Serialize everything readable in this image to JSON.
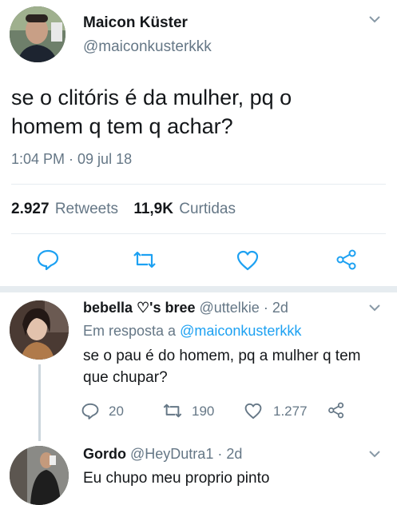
{
  "main_tweet": {
    "author_name": "Maicon Küster",
    "author_handle": "@maiconkusterkkk",
    "text_line1": "se o clitóris é da mulher, pq o",
    "text_line2": "homem q tem q achar?",
    "timestamp": "1:04 PM · 09 jul 18",
    "retweets_count": "2.927",
    "retweets_label": "Retweets",
    "likes_count": "11,9K",
    "likes_label": "Curtidas"
  },
  "reply1": {
    "author_name": "bebella ♡'s bree",
    "author_handle": "@uttelkie",
    "time": "· 2d",
    "reply_prefix": "Em resposta a",
    "reply_to": "@maiconkusterkkk",
    "text_line1": "se o pau é do homem, pq a mulher q tem",
    "text_line2": "que chupar?",
    "replies": "20",
    "retweets": "190",
    "likes": "1.277"
  },
  "reply2": {
    "author_name": "Gordo",
    "author_handle": "@HeyDutra1",
    "time": "· 2d",
    "text": "Eu chupo meu proprio pinto"
  },
  "colors": {
    "accent": "#1da1f2",
    "secondary_text": "#657786",
    "divider": "#e6ecf0"
  }
}
